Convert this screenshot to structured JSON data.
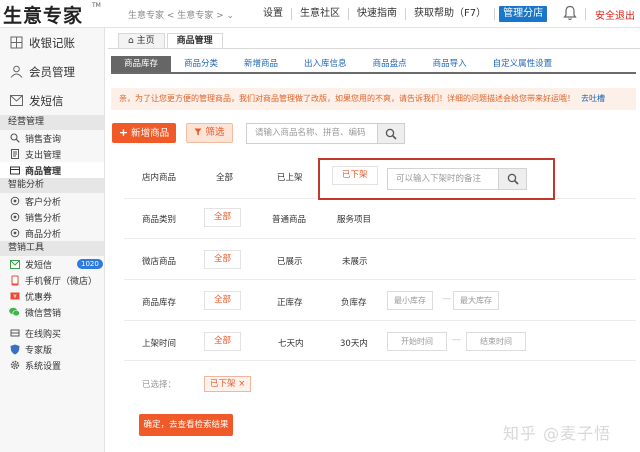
{
  "header": {
    "logo": "生意专家",
    "logo_mark": "TM",
    "store_selector": "生意专家 < 生意专家 > ⌄",
    "nav": [
      "设置",
      "生意社区",
      "快速指南",
      "获取帮助（F7）"
    ],
    "branch_button": "管理分店",
    "logout": "安全退出"
  },
  "sidebar": {
    "main_items": [
      {
        "label": "收银记账",
        "icon": "cashier-grid-icon"
      },
      {
        "label": "会员管理",
        "icon": "member-person-icon"
      },
      {
        "label": "发短信",
        "icon": "envelope-icon"
      }
    ],
    "sections": [
      {
        "title": "经营管理",
        "items": [
          {
            "label": "销售查询",
            "icon": "search-icon"
          },
          {
            "label": "支出管理",
            "icon": "expense-doc-icon"
          },
          {
            "label": "商品管理",
            "icon": "goods-icon",
            "active": true
          }
        ]
      },
      {
        "title": "智能分析",
        "items": [
          {
            "label": "客户分析",
            "icon": "refresh-circle-icon"
          },
          {
            "label": "销售分析",
            "icon": "refresh-circle-icon"
          },
          {
            "label": "商品分析",
            "icon": "refresh-circle-icon"
          }
        ]
      },
      {
        "title": "营销工具",
        "items": [
          {
            "label": "发短信",
            "icon": "envelope-icon",
            "badge": "1020"
          },
          {
            "label": "手机餐厅（微店）",
            "icon": "phone-icon"
          },
          {
            "label": "优惠券",
            "icon": "coupon-icon"
          },
          {
            "label": "微信营销",
            "icon": "wechat-icon"
          }
        ]
      }
    ],
    "bottom_items": [
      {
        "label": "在线购买",
        "icon": "cart-icon"
      },
      {
        "label": "专家版",
        "icon": "shield-icon"
      },
      {
        "label": "系统设置",
        "icon": "gear-icon"
      }
    ]
  },
  "page_tabs": [
    "主页",
    "商品管理"
  ],
  "sub_tabs": [
    "商品库存",
    "商品分类",
    "新增商品",
    "出入库信息",
    "商品盘点",
    "商品导入",
    "自定义属性设置"
  ],
  "notice": {
    "text": "亲，为了让您更方便的管理商品，我们对商品管理做了改版，如果您用的不爽，请告诉我们！详细的问题描述会给您带来好运哦！",
    "link": "去吐槽"
  },
  "toolbar": {
    "add_button": "新增商品",
    "filter_button": "筛选",
    "search_placeholder": "请输入商品名称、拼音、编码"
  },
  "filters": {
    "store_goods": {
      "label": "店内商品",
      "options": [
        "全部",
        "已上架",
        "已下架"
      ],
      "offshelf_placeholder": "可以输入下架时的备注"
    },
    "category": {
      "label": "商品类别",
      "options": [
        "全部",
        "普通商品",
        "服务项目"
      ]
    },
    "micro_store": {
      "label": "微店商品",
      "options": [
        "全部",
        "已展示",
        "未展示"
      ]
    },
    "stock": {
      "label": "商品库存",
      "options": [
        "全部",
        "正库存",
        "负库存"
      ],
      "min_placeholder": "最小库存",
      "max_placeholder": "最大库存",
      "dash": "—"
    },
    "shelf_time": {
      "label": "上架时间",
      "options": [
        "全部",
        "七天内",
        "30天内"
      ],
      "start_placeholder": "开始时间",
      "end_placeholder": "结束时间",
      "dash": "—"
    },
    "selected": {
      "label": "已选择：",
      "tag": "已下架 ×"
    }
  },
  "confirm_button": "确定，去查看检索结果",
  "watermark": "知乎 @麦子悟",
  "colors": {
    "accent": "#f05a28",
    "link": "#1e64b4",
    "highlight": "#c0392b",
    "badge": "#2d7be0"
  }
}
